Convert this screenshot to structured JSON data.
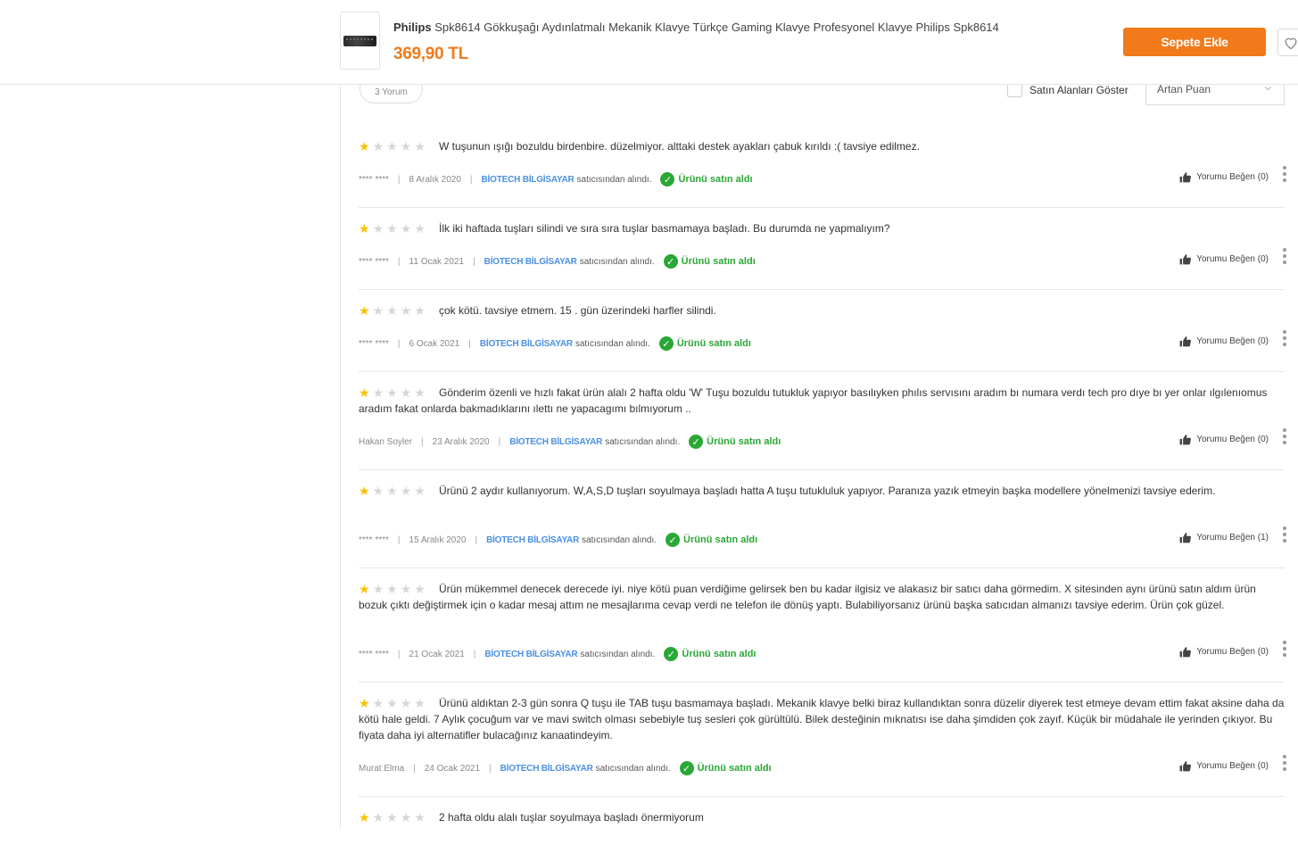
{
  "header": {
    "brand": "Philips",
    "title": "Spk8614 Gökkuşağı Aydınlatmalı Mekanik Klavye Türkçe Gaming Klavye Profesyonel Klavye Philips Spk8614",
    "price": "369,90 TL",
    "cart_label": "Sepete Ekle",
    "accent_color": "#f27a1a"
  },
  "controls": {
    "review_count": "3 Yorum",
    "buyers_label": "Satın Alanları Göster",
    "sort_value": "Artan Puan"
  },
  "common": {
    "seller_suffix": "satıcısından alındı.",
    "bought_label": "Ürünü satın aldı",
    "sep": "|",
    "seller_color": "#4a90e2",
    "star_color": "#ffc000"
  },
  "reviews": [
    {
      "rating": 1,
      "text": "W tuşunun ışığı bozuldu birdenbire. düzelmiyor. alttaki destek ayakları çabuk kırıldı :( tavsiye edilmez.",
      "user": "**** ****",
      "date": "8 Aralık 2020",
      "seller": "BİOTECH BİLGİSAYAR",
      "like_label": "Yorumu Beğen (0)"
    },
    {
      "rating": 1,
      "text": "İlk iki haftada tuşları silindi ve sıra sıra tuşlar basmamaya başladı. Bu durumda ne yapmalıyım?",
      "user": "**** ****",
      "date": "11 Ocak 2021",
      "seller": "BİOTECH BİLGİSAYAR",
      "like_label": "Yorumu Beğen (0)"
    },
    {
      "rating": 1,
      "text": "çok kötü. tavsiye etmem. 15 . gün üzerindeki harfler silindi.",
      "user": "**** ****",
      "date": "6 Ocak 2021",
      "seller": "BİOTECH BİLGİSAYAR",
      "like_label": "Yorumu Beğen (0)"
    },
    {
      "rating": 1,
      "text": "Gönderim özenli ve hızlı fakat ürün alalı 2 hafta oldu 'W' Tuşu bozuldu tutukluk yapıyor basılıyken phılıs servısını aradım bı numara verdı tech pro dıye bı yer onlar ılgılenıomus aradım fakat onlarda bakmadıklarını ılettı ne yapacagımı bılmıyorum ..",
      "user": "Hakan Soyler",
      "date": "23 Aralık 2020",
      "seller": "BİOTECH BİLGİSAYAR",
      "like_label": "Yorumu Beğen (0)"
    },
    {
      "rating": 1,
      "text": "Ürünü 2 aydır kullanıyorum. W,A,S,D tuşları soyulmaya başladı hatta A tuşu tutukluluk yapıyor. Paranıza yazık etmeyin başka modellere yönelmenizi tavsiye ederim.",
      "user": "**** ****",
      "date": "15 Aralık 2020",
      "seller": "BİOTECH BİLGİSAYAR",
      "like_label": "Yorumu Beğen (1)"
    },
    {
      "rating": 1,
      "text": "Ürün mükemmel denecek derecede iyi. niye kötü puan verdiğime gelirsek ben bu kadar ilgisiz ve alakasız bir satıcı daha görmedim. X sitesinden aynı ürünü satın aldım ürün bozuk çıktı değiştirmek için o kadar mesaj attım ne mesajlarıma cevap verdi ne telefon ile dönüş yaptı. Bulabiliyorsanız ürünü başka satıcıdan almanızı tavsiye ederim. Ürün çok güzel.",
      "user": "**** ****",
      "date": "21 Ocak 2021",
      "seller": "BİOTECH BİLGİSAYAR",
      "like_label": "Yorumu Beğen (0)"
    },
    {
      "rating": 1,
      "text": "Ürünü aldıktan 2-3 gün sonra Q tuşu ile TAB tuşu basmamaya başladı. Mekanik klavye belki biraz kullandıktan sonra düzelir diyerek test etmeye devam ettim fakat aksine daha da kötü hale geldi. 7 Aylık çocuğum var ve mavi switch olması sebebiyle tuş sesleri çok gürültülü. Bilek desteğinin mıknatısı ise daha şimdiden çok zayıf. Küçük bir müdahale ile yerinden çıkıyor. Bu fiyata daha iyi alternatifler bulacağınız kanaatindeyim.",
      "user": "Murat Elma",
      "date": "24 Ocak 2021",
      "seller": "BİOTECH BİLGİSAYAR",
      "like_label": "Yorumu Beğen (0)"
    },
    {
      "rating": 1,
      "text": "2 hafta oldu alalı tuşlar soyulmaya başladı önermiyorum",
      "user": "",
      "date": "",
      "seller": "",
      "like_label": ""
    }
  ]
}
